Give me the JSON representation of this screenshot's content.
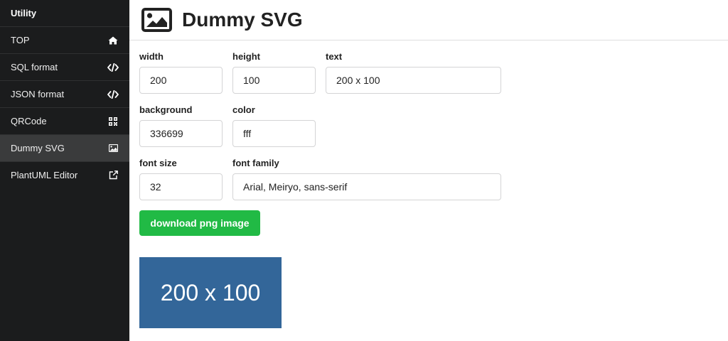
{
  "sidebar": {
    "header": "Utility",
    "items": [
      {
        "label": "TOP",
        "icon": "home-icon"
      },
      {
        "label": "SQL format",
        "icon": "code-icon"
      },
      {
        "label": "JSON format",
        "icon": "code-icon"
      },
      {
        "label": "QRCode",
        "icon": "qrcode-icon"
      },
      {
        "label": "Dummy SVG",
        "icon": "image-icon",
        "active": true
      },
      {
        "label": "PlantUML Editor",
        "icon": "external-link-icon"
      }
    ]
  },
  "page": {
    "title": "Dummy SVG",
    "icon": "image-icon"
  },
  "form": {
    "width": {
      "label": "width",
      "value": "200"
    },
    "height": {
      "label": "height",
      "value": "100"
    },
    "text": {
      "label": "text",
      "value": "200 x 100"
    },
    "background": {
      "label": "background",
      "value": "336699"
    },
    "color": {
      "label": "color",
      "value": "fff"
    },
    "font_size": {
      "label": "font size",
      "value": "32"
    },
    "font_family": {
      "label": "font family",
      "value": "Arial, Meiryo, sans-serif"
    }
  },
  "download_button": {
    "label": "download png image"
  },
  "preview": {
    "text": "200 x 100",
    "background": "#336699",
    "color": "#ffffff"
  },
  "colors": {
    "sidebar_bg": "#1b1c1d",
    "sidebar_active": "#3a3b3c",
    "button_green": "#21ba45"
  }
}
